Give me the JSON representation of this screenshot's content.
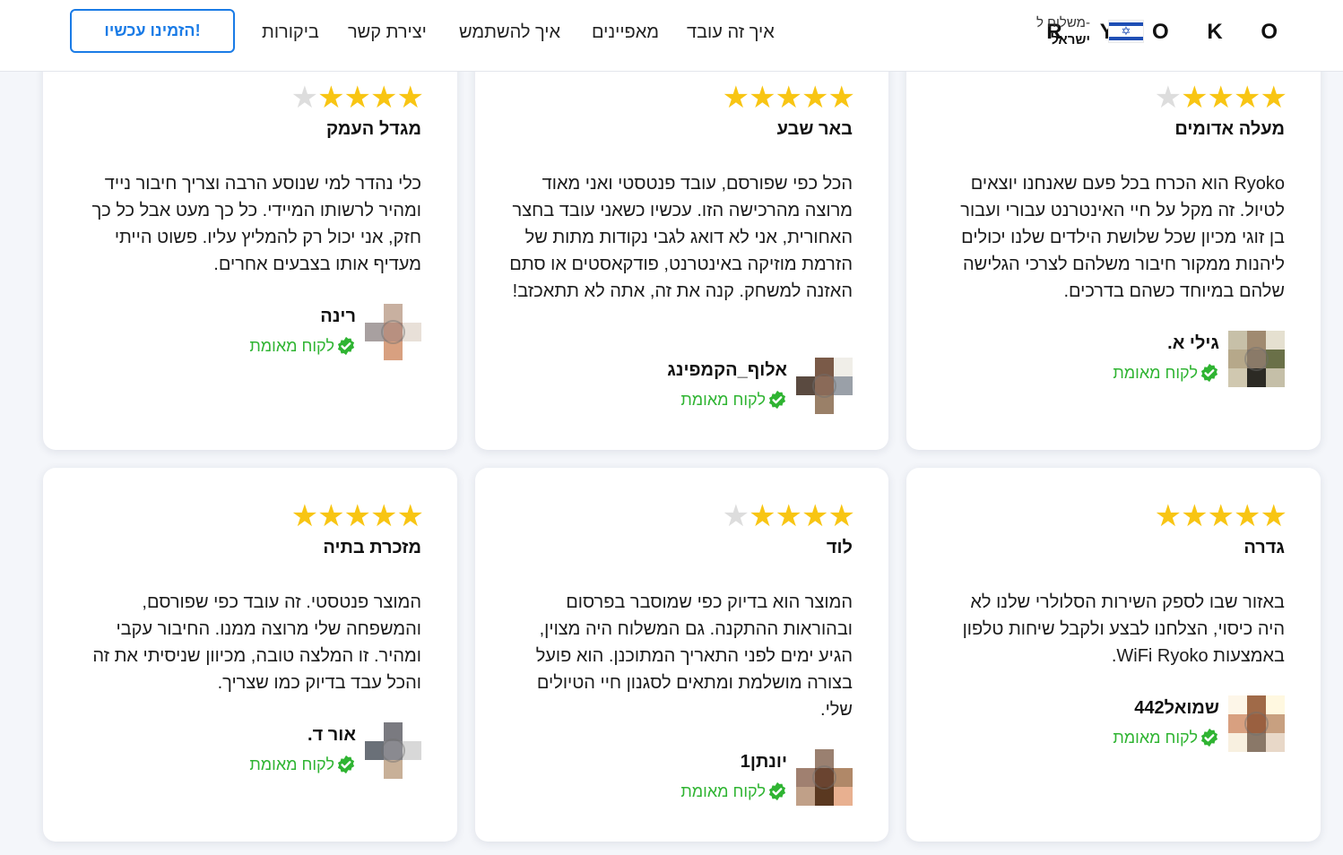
{
  "header": {
    "brand": "R Y O K O",
    "ship_to_label": "משלוח ל-",
    "ship_to_country": "ישראל",
    "nav": [
      "איך זה עובד",
      "מאפיינים",
      "איך להשתמש",
      "יצירת קשר",
      "ביקורות"
    ],
    "cta": "הזמינו עכשיו!"
  },
  "verified_label": "לקוח מאומת",
  "colors": {
    "accent": "#1a7be6",
    "star": "#f8c513",
    "verified": "#2fb432"
  },
  "reviews": [
    {
      "rating": 4,
      "city": "מעלה אדומים",
      "text": "Ryoko הוא הכרח בכל פעם שאנחנו יוצאים לטיול. זה מקל על חיי האינטרנט עבורי ועבור בן זוגי מכיון שכל שלושת הילדים שלנו יכולים ליהנות ממקור חיבור משלהם לצרכי הגלישה שלהם במיוחד כשהם בדרכים.",
      "name": "גילי א."
    },
    {
      "rating": 5,
      "city": "באר שבע",
      "text": "הכל כפי שפורסם, עובד פנטסטי ואני מאוד מרוצה מהרכישה הזו. עכשיו כשאני עובד בחצר האחורית, אני לא דואג לגבי נקודות מתות של הזרמת מוזיקה באינטרנט, פודקאסטים או סתם האזנה למשחק. קנה את זה, אתה לא תתאכזב!",
      "name": "אלוף_הקמפינג"
    },
    {
      "rating": 4,
      "city": "מגדל העמק",
      "text": "כלי נהדר למי שנוסע הרבה וצריך חיבור נייד ומהיר לרשותו המיידי. כל כך מעט אבל כל כך חזק, אני יכול רק להמליץ עליו. פשוט הייתי מעדיף אותו בצבעים אחרים.",
      "name": "רינה"
    },
    {
      "rating": 5,
      "city": "גדרה",
      "text": "באזור שבו לספק השירות הסלולרי שלנו לא היה כיסוי, הצלחנו לבצע ולקבל שיחות טלפון באמצעות WiFi Ryoko.",
      "name": "שמואל442"
    },
    {
      "rating": 4,
      "city": "לוד",
      "text": "המוצר הוא בדיוק כפי שמוסבר בפרסום ובהוראות ההתקנה. גם המשלוח היה מצוין, הגיע ימים לפני התאריך המתוכנן. הוא פועל בצורה מושלמת ומתאים לסגנון חיי הטיולים שלי.",
      "name": "יונתן1"
    },
    {
      "rating": 5,
      "city": "מזכרת בתיה",
      "text": "המוצר פנטסטי. זה עובד כפי שפורסם, והמשפחה שלי מרוצה ממנו. החיבור עקבי ומהיר. זו המלצה טובה, מכיוון שניסיתי את זה והכל עבד בדיוק כמו שצריך.",
      "name": "אור ד."
    }
  ]
}
